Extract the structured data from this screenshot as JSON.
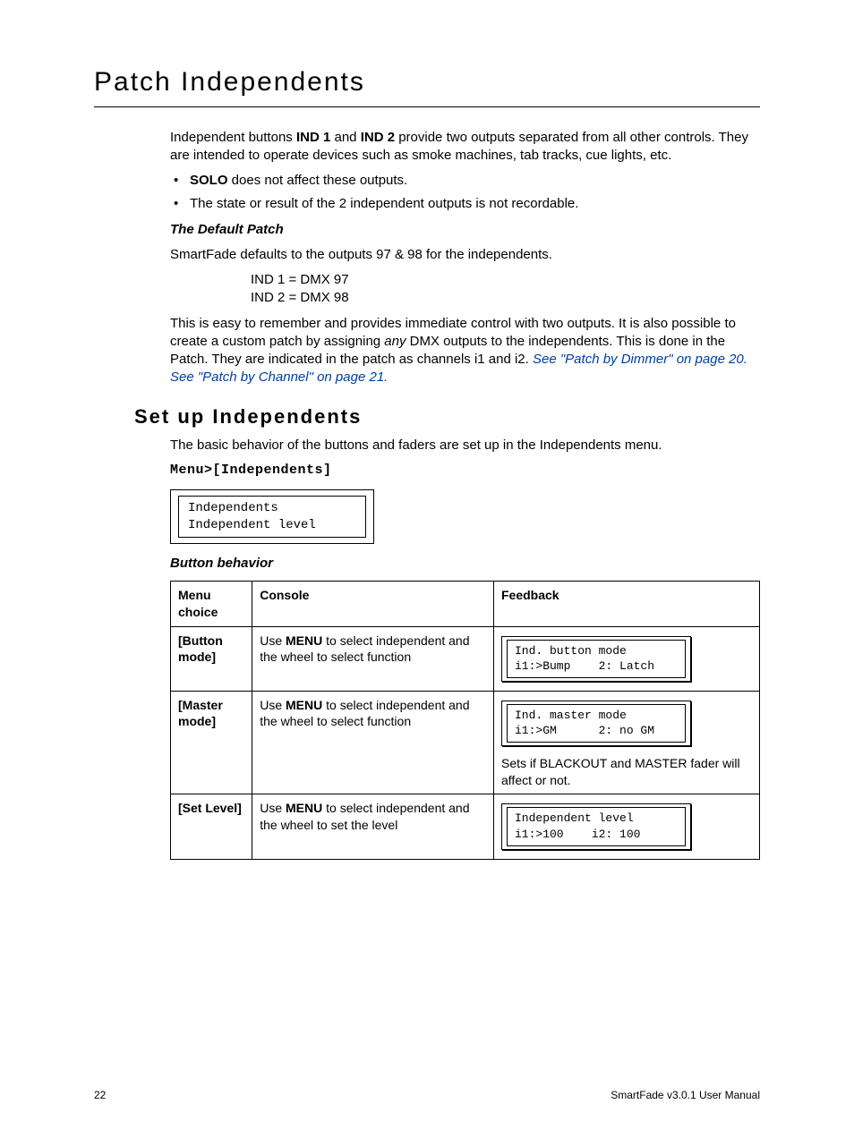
{
  "section_title": "Patch Independents",
  "intro_para1_a": "Independent buttons ",
  "intro_ind1": "IND 1",
  "intro_and": " and ",
  "intro_ind2": "IND 2",
  "intro_para1_b": " provide two outputs separated from all other controls. They are intended to operate devices such as smoke machines, tab tracks, cue lights, etc.",
  "bullet1_bold": "SOLO",
  "bullet1_rest": " does not affect these outputs.",
  "bullet2": "The state or result of the 2 independent outputs is not recordable.",
  "default_patch_heading": "The Default Patch",
  "default_patch_text": "SmartFade defaults to the outputs 97 & 98 for the independents.",
  "ind1_line": "IND 1 = DMX 97",
  "ind2_line": "IND 2 = DMX 98",
  "para2_a": "This is easy to remember and provides immediate control with two outputs. It is also possible to create a custom patch by assigning ",
  "para2_any": "any",
  "para2_b": " DMX outputs to the independents. This is done in the Patch. They are indicated in the patch as channels i1 and i2. ",
  "xref1": "See \"Patch by Dimmer\" on page 20.",
  "xref_sep": " ",
  "xref2": "See \"Patch by Channel\" on page 21.",
  "subsection_title": "Set up Independents",
  "sub_intro": "The basic behavior of the buttons and faders are set up in the Independents menu.",
  "menu_line": "Menu>[Independents]",
  "lcd_main_text": "Independents\nIndependent level",
  "button_behavior_heading": "Button behavior",
  "table": {
    "headers": {
      "c1": "Menu choice",
      "c2": "Console",
      "c3": "Feedback"
    },
    "rows": [
      {
        "menu": "[Button mode]",
        "console_pre": "Use ",
        "console_bold": "MENU",
        "console_post": " to select independent and the wheel to select function",
        "lcd": "Ind. button mode\ni1:>Bump    2: Latch",
        "note": ""
      },
      {
        "menu": "[Master mode]",
        "console_pre": "Use ",
        "console_bold": "MENU",
        "console_post": " to select independent and the wheel to select function",
        "lcd": "Ind. master mode\ni1:>GM      2: no GM",
        "note": "Sets if BLACKOUT and MASTER fader will affect or not."
      },
      {
        "menu": "[Set Level]",
        "console_pre": "Use ",
        "console_bold": "MENU",
        "console_post": " to select independent and the wheel to set the level",
        "lcd": "Independent level\ni1:>100    i2: 100",
        "note": ""
      }
    ]
  },
  "footer_left": "22",
  "footer_right": "SmartFade v3.0.1 User Manual"
}
